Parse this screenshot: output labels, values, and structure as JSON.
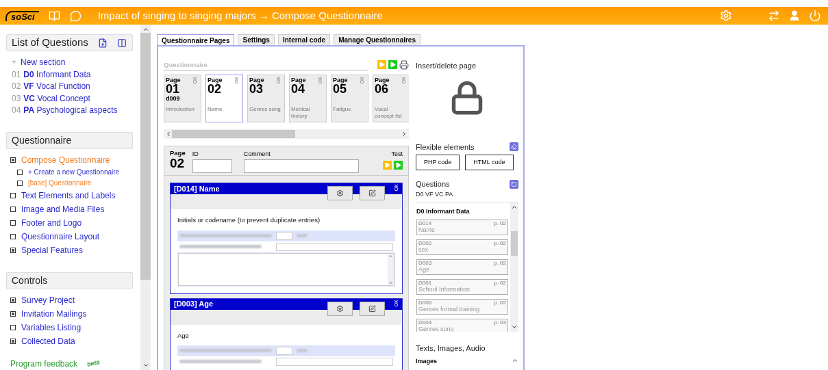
{
  "header": {
    "logo": "soSci",
    "title": "Impact of singing to singing majors → Compose Questionnaire"
  },
  "sidebar": {
    "list_of_questions": {
      "title": "List of Questions",
      "items": [
        {
          "kind": "add",
          "marker": "+",
          "label": "New section"
        },
        {
          "kind": "section",
          "number": "01",
          "code": "D0",
          "label": "Informant Data"
        },
        {
          "kind": "section",
          "number": "02",
          "code": "VF",
          "label": "Vocal Function"
        },
        {
          "kind": "section",
          "number": "03",
          "code": "VC",
          "label": "Vocal Concept"
        },
        {
          "kind": "section",
          "number": "04",
          "code": "PA",
          "label": "Psychological aspects"
        }
      ]
    },
    "menus": [
      {
        "title": "Questionnaire",
        "items": [
          {
            "kind": "group",
            "label": "Compose Questionnaire",
            "selected": true,
            "children": [
              {
                "kind": "leaf",
                "label": "+ Create a new Questionnaire",
                "selected": false
              },
              {
                "kind": "leaf",
                "label": "[base] Questionnaire",
                "selected": true
              }
            ]
          },
          {
            "kind": "leaf",
            "label": "Text Elements and Labels",
            "selected": false
          },
          {
            "kind": "leaf",
            "label": "Image and Media Files",
            "selected": false
          },
          {
            "kind": "leaf",
            "label": "Footer and Logo",
            "selected": false
          },
          {
            "kind": "leaf",
            "label": "Questionnaire Layout",
            "selected": false
          },
          {
            "kind": "group",
            "label": "Special Features",
            "selected": false
          }
        ]
      },
      {
        "title": "Controls",
        "items": [
          {
            "kind": "group",
            "label": "Survey Project",
            "selected": false
          },
          {
            "kind": "group",
            "label": "Invitation Mailings",
            "selected": false
          },
          {
            "kind": "leaf",
            "label": "Variables Listing",
            "selected": false
          },
          {
            "kind": "group",
            "label": "Collected Data",
            "selected": false
          }
        ]
      }
    ],
    "feedback": {
      "label": "Program feedback",
      "badge": "beta"
    }
  },
  "tabs": [
    {
      "label": "Questionnaire Pages",
      "selected": true
    },
    {
      "label": "Settings",
      "selected": false
    },
    {
      "label": "Internal code",
      "selected": false
    },
    {
      "label": "Manage Questionnaires",
      "selected": false
    }
  ],
  "pages": {
    "title": "Questionnaire",
    "items": [
      {
        "label": "Page",
        "number": "01",
        "id": "d009",
        "title": "Introduction",
        "status": "OK",
        "selected": false
      },
      {
        "label": "Page",
        "number": "02",
        "title": "Name",
        "status": "OK",
        "selected": true
      },
      {
        "label": "Page",
        "number": "03",
        "title": "Genres sung",
        "status": "OK",
        "selected": false
      },
      {
        "label": "Page",
        "number": "04",
        "title": "Medical history",
        "status": "OK",
        "selected": false
      },
      {
        "label": "Page",
        "number": "05",
        "title": "Fatigue",
        "status": "OK",
        "selected": false
      },
      {
        "label": "Page",
        "number": "06",
        "title": "Vocal concept list",
        "status": "OK",
        "selected": false
      }
    ]
  },
  "page_editor": {
    "page_label": "Page",
    "page_number": "02",
    "id_label": "ID",
    "comment_label": "Comment",
    "test_label": "Test",
    "questions": [
      {
        "header": "[D014] Name",
        "status": "OK",
        "prompt": "Initials or codename (to prevent duplicate entries)",
        "textarea": true
      },
      {
        "header": "[D003] Age",
        "status": "OK",
        "prompt": "Age",
        "textarea": false
      }
    ]
  },
  "right_panel": {
    "insert_delete": "Insert/delete page",
    "flexible": {
      "title": "Flexible elements",
      "buttons": [
        "PHP code",
        "HTML code"
      ]
    },
    "questions": {
      "title": "Questions",
      "filter": "D0 VF VC PA",
      "group": "D0 Informant Data",
      "items": [
        {
          "code": "D014",
          "page": "p. 02",
          "title": "Name"
        },
        {
          "code": "D002",
          "page": "p. 02",
          "title": "sex"
        },
        {
          "code": "D003",
          "page": "p. 02",
          "title": "Age"
        },
        {
          "code": "D001",
          "page": "p. 02",
          "title": "School Information"
        },
        {
          "code": "D006",
          "page": "p. 02",
          "title": "Genres formal training"
        },
        {
          "code": "D004",
          "page": "p. 03",
          "title": "Genres sung"
        }
      ]
    },
    "media": {
      "title": "Texts, Images, Audio",
      "group": "Images"
    }
  }
}
